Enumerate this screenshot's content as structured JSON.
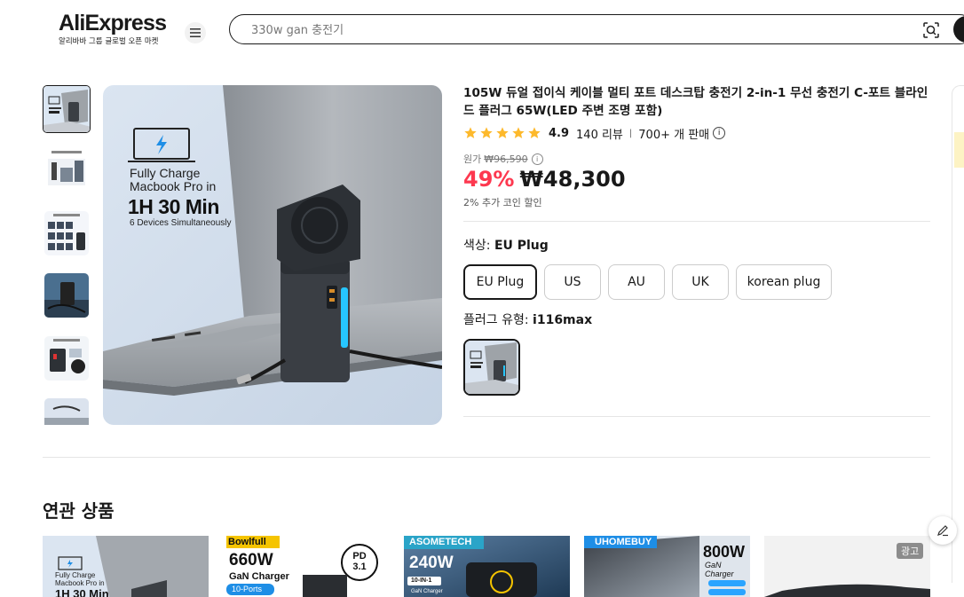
{
  "header": {
    "logo": "AliExpress",
    "logo_sub": "알리바바 그룹 글로벌 오픈 마켓",
    "search_placeholder": "330w gan 충전기"
  },
  "product": {
    "title": "105W 듀얼 접이식 케이블 멀티 포트 데스크탑 충전기 2-in-1 무선 충전기 C-포트 블라인드 플러그 65W(LED 주변 조명 포함)",
    "rating": "4.9",
    "reviews": "140 리뷰",
    "sold": "700+ 개 판매",
    "original_price_label": "원가",
    "original_price": "₩96,590",
    "discount": "49%",
    "price": "₩48,300",
    "coin_discount": "2% 추가 코인 할인",
    "stars": 5
  },
  "main_image": {
    "headline1": "Fully Charge",
    "headline2": "Macbook Pro in",
    "headline3": "1H 30 Min",
    "headline4": "6 Devices Simultaneously"
  },
  "color": {
    "label": "색상:",
    "selected": "EU Plug",
    "options": [
      "EU Plug",
      "US",
      "AU",
      "UK",
      "korean plug"
    ]
  },
  "plug_type": {
    "label": "플러그 유형:",
    "selected": "i116max"
  },
  "related": {
    "title": "연관 상품",
    "cards": [
      {
        "brand": "",
        "text1": "Fully Charge",
        "text2": "Macbook Pro in",
        "text3": "1H 30 Min"
      },
      {
        "brand": "Bowlfull",
        "text1": "660W",
        "text2": "GaN Charger",
        "text3": "10-Ports",
        "badge": "PD 3.1"
      },
      {
        "brand": "ASOMETECH",
        "text1": "240W",
        "text2": "10-IN-1",
        "text3": "GaN Charger"
      },
      {
        "brand": "UHOMEBUY",
        "text1": "800W",
        "text2": "GaN Charger",
        "text3": ""
      },
      {
        "brand": "",
        "ad": "광고"
      }
    ]
  },
  "colors": {
    "accent_red": "#fd384f",
    "star": "#fdb92c",
    "text": "#191919"
  }
}
